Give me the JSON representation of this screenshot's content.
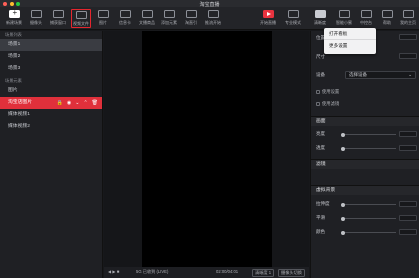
{
  "window": {
    "title": "淘宝直播"
  },
  "colors": {
    "accent": "#e0303b",
    "close": "#ff5f57",
    "minimize": "#febc2e",
    "maximize": "#28c840"
  },
  "toolbar": {
    "items": [
      {
        "label": "新建场景",
        "icon": "add-scene-icon"
      },
      {
        "label": "摄像头",
        "icon": "camera-icon"
      },
      {
        "label": "捕获窗口",
        "icon": "window-capture-icon"
      },
      {
        "label": "视频文件",
        "icon": "video-file-icon"
      },
      {
        "label": "图片",
        "icon": "image-icon"
      },
      {
        "label": "信息卡",
        "icon": "info-card-icon"
      },
      {
        "label": "文播商品",
        "icon": "product-icon"
      },
      {
        "label": "添加元素",
        "icon": "add-element-icon"
      },
      {
        "label": "淘直引",
        "icon": "link-icon"
      },
      {
        "label": "推流开始",
        "icon": "stream-icon"
      },
      {
        "label": "开始直播",
        "icon": "play-icon"
      },
      {
        "label": "专业模式",
        "icon": "pro-mode-icon"
      },
      {
        "label": "清晰度",
        "icon": "resolution-icon"
      },
      {
        "label": "智能小蜜",
        "icon": "assistant-icon"
      },
      {
        "label": "中控台",
        "icon": "console-icon"
      },
      {
        "label": "帮助",
        "icon": "help-icon"
      },
      {
        "label": "我的主页",
        "icon": "home-icon"
      }
    ]
  },
  "left_panel": {
    "scenes_header": "场景列表",
    "scenes": [
      "场景1",
      "场景2",
      "场景3"
    ],
    "elements_header": "场景元素",
    "elements": [
      "图片",
      "淘宝店图片",
      "媒体视频1",
      "媒体视频2"
    ]
  },
  "playbar": {
    "mode": "5G",
    "status": "已收到 (LIVE)",
    "time": "02:00/04:01",
    "btn1": "清晰度 1",
    "btn2": "摄像头切换"
  },
  "popup": {
    "items": [
      "打开看板",
      "更多设置"
    ]
  },
  "right_panel": {
    "position_label": "位置",
    "size_label": "尺寸",
    "device_label": "设备",
    "device_value": "选择设备",
    "check1": "使用设置",
    "check2": "使用滤镜",
    "image_section": "画面",
    "brightness_label": "亮度",
    "contrast_label": "透度",
    "filter_section": "滤镜",
    "virtual_section": "虚拟背景",
    "v1": "拉伸度",
    "v2": "平滑",
    "v3": "颜色"
  }
}
